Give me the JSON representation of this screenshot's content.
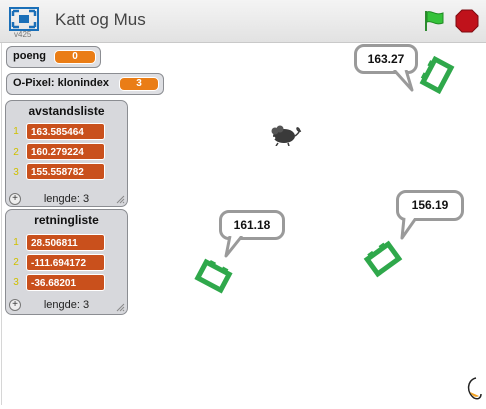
{
  "header": {
    "version": "v425",
    "project_title": "Katt og Mus"
  },
  "monitors": {
    "poeng": {
      "label": "poeng",
      "value": "0"
    },
    "klonindex": {
      "label": "O-Pixel: klonindex",
      "value": "3"
    }
  },
  "lists": {
    "avstandsliste": {
      "title": "avstandsliste",
      "items": [
        "163.585464",
        "160.279224",
        "155.558782"
      ],
      "indices": [
        "1",
        "2",
        "3"
      ],
      "length_label": "lengde: 3"
    },
    "retningliste": {
      "title": "retningliste",
      "items": [
        "28.506811",
        "-111.694172",
        "-36.68201"
      ],
      "indices": [
        "1",
        "2",
        "3"
      ],
      "length_label": "lengde: 3"
    }
  },
  "bubbles": [
    "163.27",
    "161.18",
    "156.19"
  ],
  "colors": {
    "variable_orange": "#ea7d16",
    "list_cell": "#c9501c",
    "sprite_green": "#2fa84b",
    "flag_green": "#35c23a",
    "stop_red": "#c0121b"
  },
  "icons": {
    "fullscreen": "fullscreen-icon",
    "green_flag": "green-flag-icon",
    "stop": "stop-icon"
  }
}
